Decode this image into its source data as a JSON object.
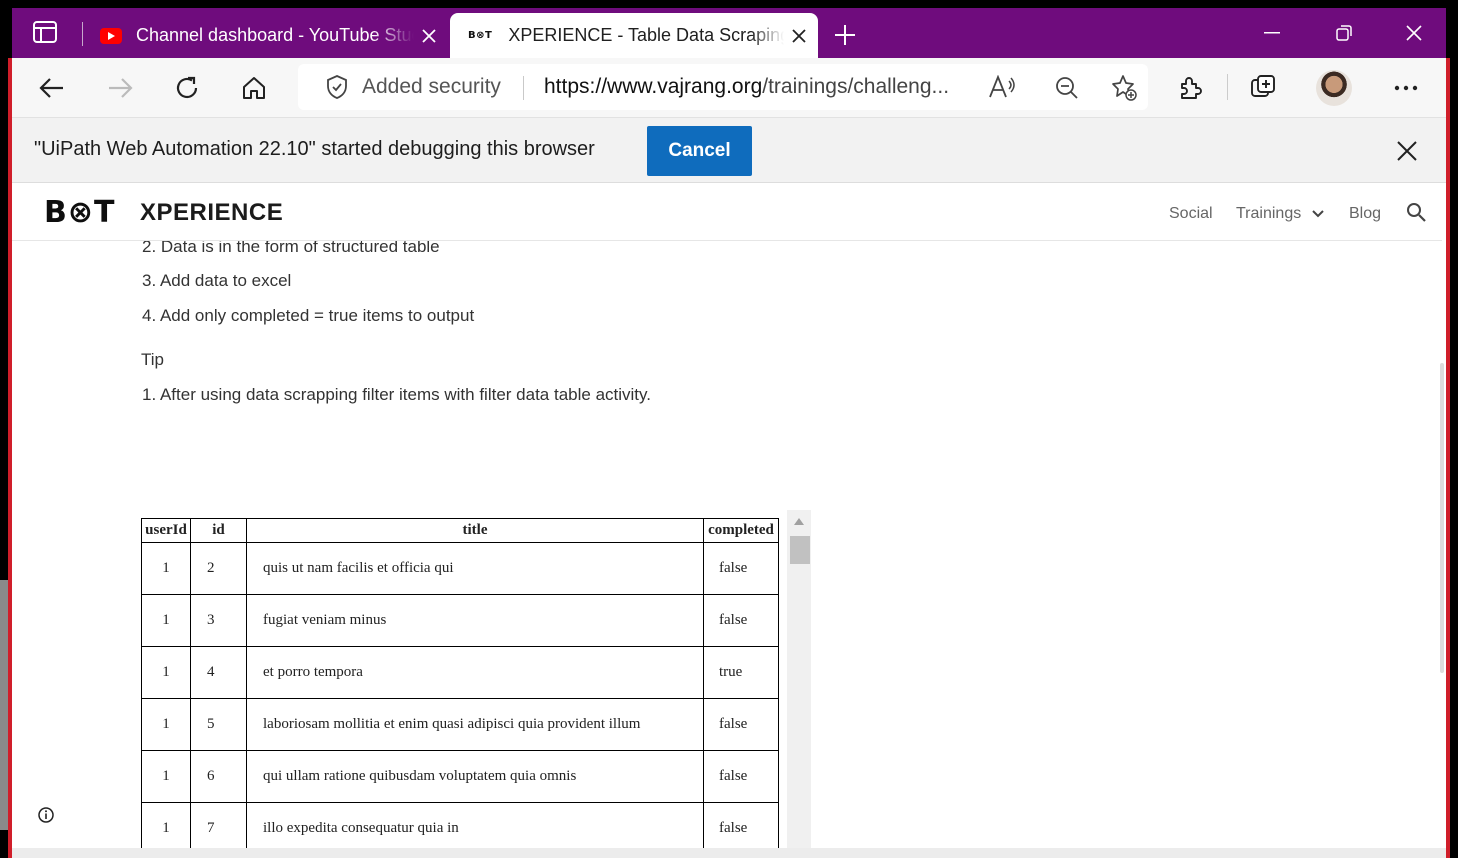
{
  "browser": {
    "tabs": [
      {
        "title": "Channel dashboard - YouTube Studio",
        "favicon": "youtube-icon",
        "active": false
      },
      {
        "title": "XPERIENCE - Table Data Scraping",
        "favicon": "botxperience-icon",
        "favicon_text": "B⊗T",
        "active": true
      }
    ],
    "address": {
      "security_label": "Added security",
      "url_domain": "https://www.vajrang.org",
      "url_path": "/trainings/challeng..."
    },
    "infobar": {
      "message": "\"UiPath Web Automation 22.10\" started debugging this browser",
      "cancel_label": "Cancel"
    }
  },
  "site": {
    "logo": "B⊗T",
    "brand": "XPERIENCE",
    "nav": {
      "social": "Social",
      "trainings": "Trainings",
      "blog": "Blog"
    }
  },
  "content": {
    "item2": "2. Data is in the form of structured table",
    "item3": "3. Add data to excel",
    "item4": "4. Add only completed = true items to output",
    "tip_heading": "Tip",
    "tip1": "1. After using data scrapping filter items with filter data table activity."
  },
  "table": {
    "headers": {
      "userId": "userId",
      "id": "id",
      "title": "title",
      "completed": "completed"
    },
    "rows": [
      {
        "userId": "1",
        "id": "2",
        "title": "quis ut nam facilis et officia qui",
        "completed": "false"
      },
      {
        "userId": "1",
        "id": "3",
        "title": "fugiat veniam minus",
        "completed": "false"
      },
      {
        "userId": "1",
        "id": "4",
        "title": "et porro tempora",
        "completed": "true"
      },
      {
        "userId": "1",
        "id": "5",
        "title": "laboriosam mollitia et enim quasi adipisci quia provident illum",
        "completed": "false"
      },
      {
        "userId": "1",
        "id": "6",
        "title": "qui ullam ratione quibusdam voluptatem quia omnis",
        "completed": "false"
      },
      {
        "userId": "1",
        "id": "7",
        "title": "illo expedita consequatur quia in",
        "completed": "false"
      }
    ]
  },
  "colors": {
    "tabstrip": "#6f0c7d",
    "accent_button": "#0f6cbd",
    "border_red": "#d01e2a"
  }
}
